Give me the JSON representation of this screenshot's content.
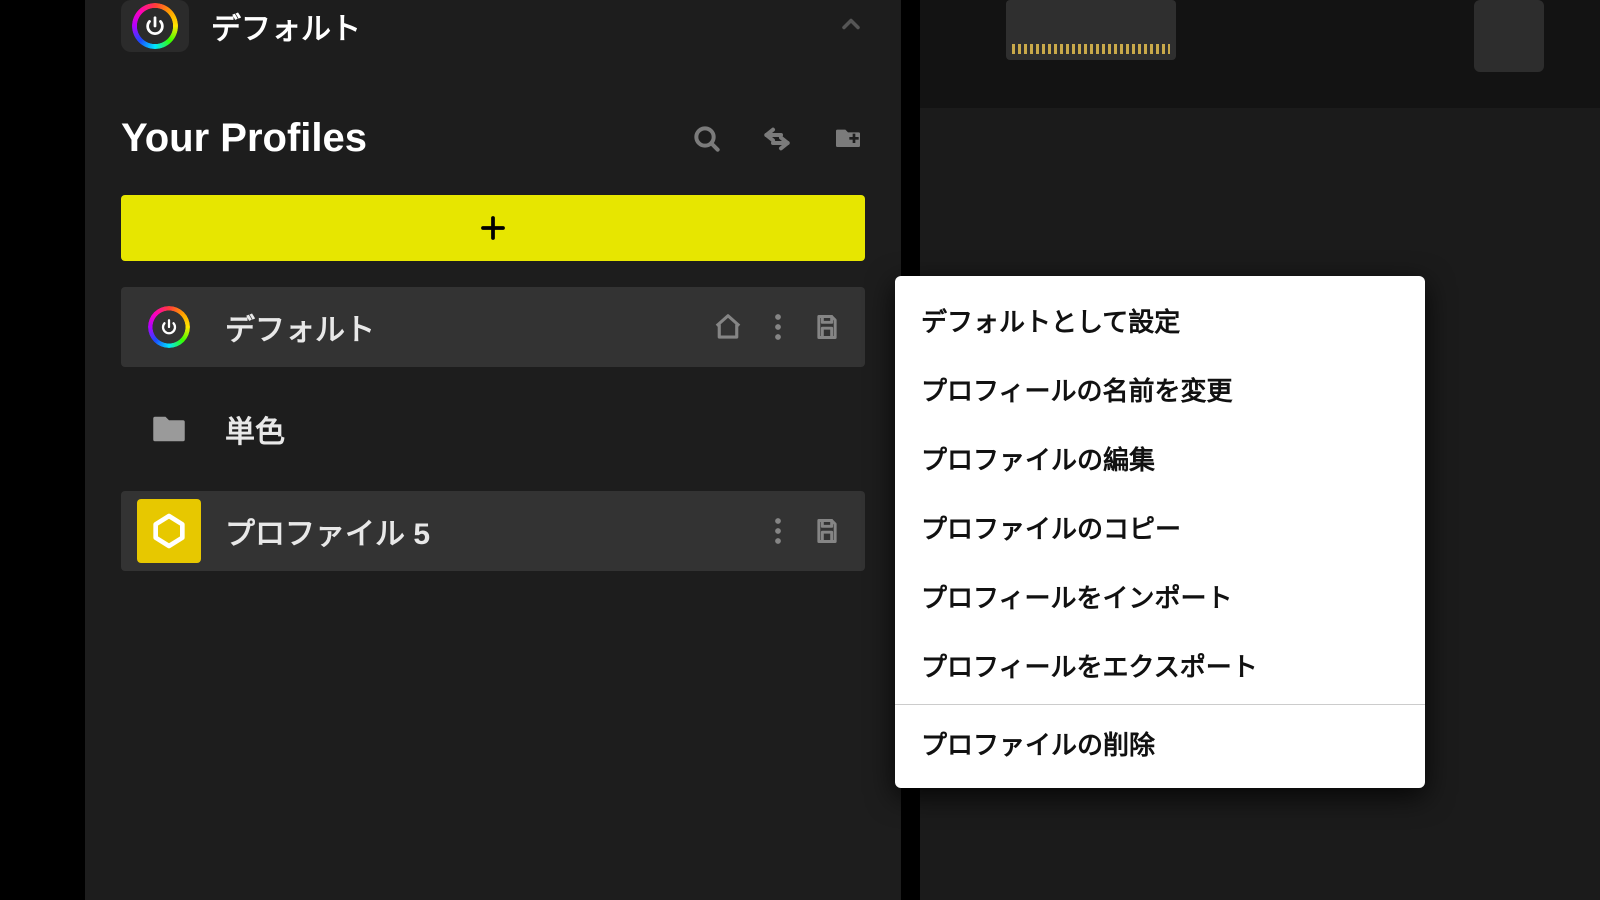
{
  "header": {
    "title": "デフォルト"
  },
  "profilesHeader": {
    "title": "Your Profiles"
  },
  "profiles": [
    {
      "label": "デフォルト",
      "home": true,
      "more": true,
      "save": true
    },
    {
      "label": "単色",
      "folder": true
    },
    {
      "label": "プロファイル 5",
      "hex": true,
      "more": true,
      "save": true
    }
  ],
  "contextMenu": [
    "デフォルトとして設定",
    "プロフィールの名前を変更",
    "プロファイルの編集",
    "プロファイルのコピー",
    "プロフィールをインポート",
    "プロフィールをエクスポート",
    "—",
    "プロファイルの削除"
  ]
}
